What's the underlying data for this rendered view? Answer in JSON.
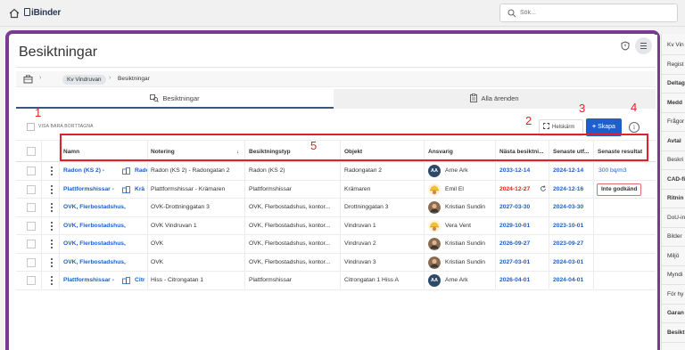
{
  "app": {
    "logo_text": "iBinder"
  },
  "search": {
    "placeholder": "Sök..."
  },
  "page": {
    "title": "Besiktningar"
  },
  "breadcrumb": {
    "project": "Kv Vindruvan",
    "current": "Besiktningar"
  },
  "tabs": [
    {
      "label": "Besiktningar",
      "active": true
    },
    {
      "label": "Alla ärenden",
      "active": false
    }
  ],
  "filters": {
    "show_removed_label": "VISA BARA BORTTAGNA"
  },
  "toolbar": {
    "fullscreen_label": "Helskärm",
    "create_label": "Skapa",
    "info_glyph": "i"
  },
  "annotations": [
    "1",
    "2",
    "3",
    "4",
    "5"
  ],
  "columns": [
    "Namn",
    "Notering",
    "Besiktningstyp",
    "Objekt",
    "Ansvarig",
    "Nästa besiktni...",
    "Senaste utf...",
    "Senaste resultat"
  ],
  "rows": [
    {
      "name": "Radon (KS 2) -",
      "name2": "Radong",
      "note": "Radon (KS 2) - Radongatan 2",
      "type": "Radon (KS 2)",
      "object": "Radongatan 2",
      "responsible": "Arne Ark",
      "avatar": "AA",
      "avatar_kind": "text",
      "next": "2033-12-14",
      "next_overdue": false,
      "last": "2024-12-14",
      "result": "300 bq/m3",
      "result_kind": "link",
      "has_refresh": false
    },
    {
      "name": "Plattformshissar -",
      "name2": "Krä",
      "note": "Plattformshissar - Krämaren",
      "type": "Plattformshissar",
      "object": "Krämaren",
      "responsible": "Emil El",
      "avatar": "",
      "avatar_kind": "helmet",
      "next": "2024-12-27",
      "next_overdue": true,
      "last": "2024-12-16",
      "result": "Inte godkänd",
      "result_kind": "fail",
      "has_refresh": true
    },
    {
      "name": "OVK, Flerbostadshus, kontor",
      "name2": "",
      "note": "OVK-Drottninggatan 3",
      "type": "OVK, Flerbostadshus, kontor...",
      "object": "Drottninggatan 3",
      "responsible": "Kristian Sundin",
      "avatar": "",
      "avatar_kind": "photo",
      "next": "2027-03-30",
      "next_overdue": false,
      "last": "2024-03-30",
      "result": "",
      "result_kind": "none",
      "has_refresh": false
    },
    {
      "name": "OVK, Flerbostadshus, kontor",
      "name2": "",
      "note": "OVK Vindruvan 1",
      "type": "OVK, Flerbostadshus, kontor...",
      "object": "Vindruvan 1",
      "responsible": "Vera Vent",
      "avatar": "",
      "avatar_kind": "helmet",
      "next": "2029-10-01",
      "next_overdue": false,
      "last": "2023-10-01",
      "result": "",
      "result_kind": "none",
      "has_refresh": false
    },
    {
      "name": "OVK, Flerbostadshus, kontor",
      "name2": "",
      "note": "OVK",
      "type": "OVK, Flerbostadshus, kontor...",
      "object": "Vindruvan 2",
      "responsible": "Kristian Sundin",
      "avatar": "",
      "avatar_kind": "photo",
      "next": "2026-09-27",
      "next_overdue": false,
      "last": "2023-09-27",
      "result": "",
      "result_kind": "none",
      "has_refresh": false
    },
    {
      "name": "OVK, Flerbostadshus, kontor",
      "name2": "",
      "note": "OVK",
      "type": "OVK, Flerbostadshus, kontor...",
      "object": "Vindruvan 3",
      "responsible": "Kristian Sundin",
      "avatar": "",
      "avatar_kind": "photo",
      "next": "2027-03-01",
      "next_overdue": false,
      "last": "2024-03-01",
      "result": "",
      "result_kind": "none",
      "has_refresh": false
    },
    {
      "name": "Plattformshissar -",
      "name2": "Citr",
      "note": "Hiss - Citrongatan 1",
      "type": "Plattformshissar",
      "object": "Citrongatan 1 Hiss A",
      "responsible": "Arne Ark",
      "avatar": "AA",
      "avatar_kind": "text",
      "next": "2026-04-01",
      "next_overdue": false,
      "last": "2024-04-01",
      "result": "",
      "result_kind": "none",
      "has_refresh": false
    }
  ],
  "right_sidebar": [
    {
      "label": "Kv Vin",
      "bold": false
    },
    {
      "label": "Regist",
      "bold": false
    },
    {
      "label": "Deltag",
      "bold": true
    },
    {
      "label": "Medd",
      "bold": true
    },
    {
      "label": "Frågor",
      "bold": false
    },
    {
      "label": "Avtal",
      "bold": true
    },
    {
      "label": "Beskri",
      "bold": false
    },
    {
      "label": "CAD-fi",
      "bold": true
    },
    {
      "label": "Ritnin",
      "bold": true
    },
    {
      "label": "DoU-in",
      "bold": false
    },
    {
      "label": "Bilder",
      "bold": false
    },
    {
      "label": "Miljö",
      "bold": false
    },
    {
      "label": "Myndi",
      "bold": false
    },
    {
      "label": "För hy",
      "bold": false
    },
    {
      "label": "Garan",
      "bold": true
    },
    {
      "label": "Besikt",
      "bold": true
    }
  ],
  "colors": {
    "frame": "#7a3b8f",
    "primary": "#1f5fc8",
    "annotation": "#e2202a",
    "overdue": "#dd2222"
  }
}
